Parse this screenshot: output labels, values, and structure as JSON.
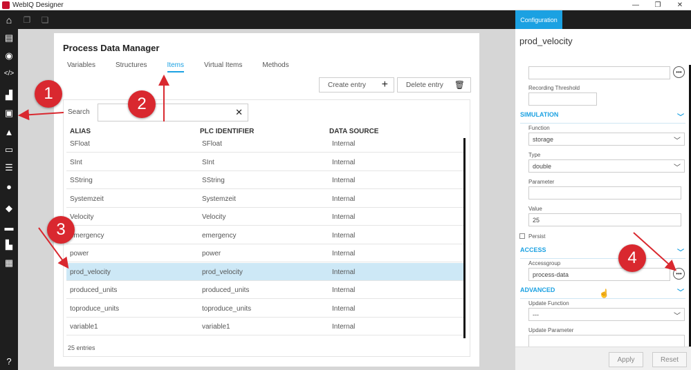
{
  "window": {
    "title": "WebIQ Designer",
    "controls": [
      "—",
      "❐",
      "✕"
    ]
  },
  "toolbar": {
    "config_tab": "Configuration"
  },
  "sidebar": {
    "help": "?"
  },
  "manager": {
    "title": "Process Data Manager",
    "tabs": [
      "Variables",
      "Structures",
      "Items",
      "Virtual Items",
      "Methods"
    ],
    "active_tab": "Items",
    "create_label": "Create entry",
    "delete_label": "Delete entry",
    "search_label": "Search",
    "search_value": "",
    "columns": [
      "ALIAS",
      "PLC IDENTIFIER",
      "DATA SOURCE"
    ],
    "rows": [
      [
        "SFloat",
        "SFloat",
        "Internal"
      ],
      [
        "SInt",
        "SInt",
        "Internal"
      ],
      [
        "SString",
        "SString",
        "Internal"
      ],
      [
        "Systemzeit",
        "Systemzeit",
        "Internal"
      ],
      [
        "Velocity",
        "Velocity",
        "Internal"
      ],
      [
        "emergency",
        "emergency",
        "Internal"
      ],
      [
        "power",
        "power",
        "Internal"
      ],
      [
        "prod_velocity",
        "prod_velocity",
        "Internal"
      ],
      [
        "produced_units",
        "produced_units",
        "Internal"
      ],
      [
        "toproduce_units",
        "toproduce_units",
        "Internal"
      ],
      [
        "variable1",
        "variable1",
        "Internal"
      ]
    ],
    "selected_row": "prod_velocity",
    "entries": "25 entries"
  },
  "config": {
    "title": "prod_velocity",
    "recording_threshold_label": "Recording Threshold",
    "simulation_label": "SIMULATION",
    "function_label": "Function",
    "function_value": "storage",
    "type_label": "Type",
    "type_value": "double",
    "parameter_label": "Parameter",
    "parameter_value": "",
    "value_label": "Value",
    "value_value": "25",
    "persist_label": "Persist",
    "access_label": "ACCESS",
    "accessgroup_label": "Accessgroup",
    "accessgroup_value": "process-data",
    "advanced_label": "ADVANCED",
    "update_function_label": "Update Function",
    "update_function_value": "---",
    "update_parameter_label": "Update Parameter",
    "apply_label": "Apply",
    "reset_label": "Reset"
  },
  "callouts": [
    "1",
    "2",
    "3",
    "4"
  ],
  "colors": {
    "accent": "#1ba1e2",
    "callout": "#d9282f",
    "selected_row": "#cde8f6"
  }
}
